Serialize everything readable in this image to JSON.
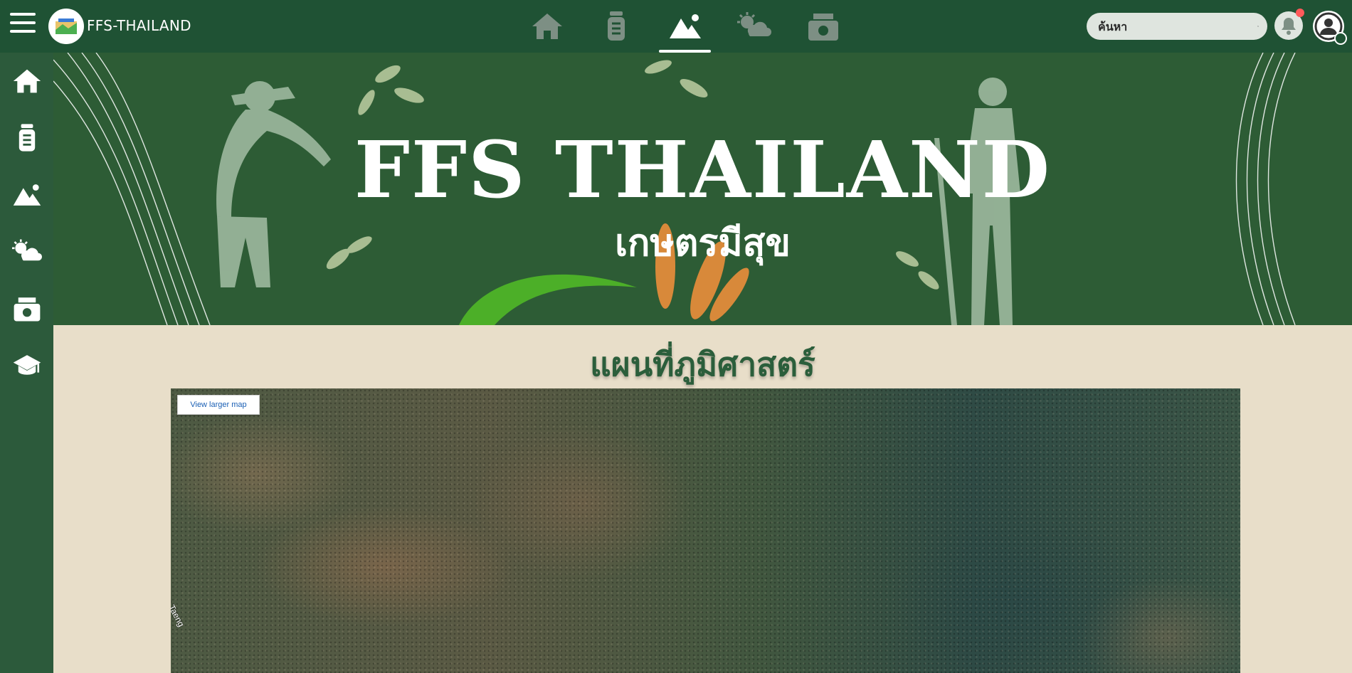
{
  "header": {
    "brand": "FFS-THAILAND",
    "nav_icons": [
      "home-icon",
      "jar-icon",
      "mountain-icon",
      "weather-icon",
      "money-icon"
    ],
    "active_nav": "mountain-icon",
    "search": {
      "placeholder": "ค้นหา"
    },
    "notification_badge_color": "#ff5a5a"
  },
  "sidebar": {
    "items": [
      {
        "icon": "home-icon"
      },
      {
        "icon": "jar-icon"
      },
      {
        "icon": "mountain-icon"
      },
      {
        "icon": "weather-icon"
      },
      {
        "icon": "money-icon"
      },
      {
        "icon": "graduation-cap-icon"
      }
    ]
  },
  "banner": {
    "title": "FFS THAILAND",
    "subtitle": "เกษตรมีสุข"
  },
  "section": {
    "title": "แผนที่ภูมิศาสตร์"
  },
  "map": {
    "view_larger_label": "View larger map",
    "road_label": "Om Taeng"
  },
  "colors": {
    "topbar": "#1f5234",
    "sidebar": "#2c5a3b",
    "banner": "#2d5c35",
    "page_bg": "#e8dec9",
    "section_title": "#2b5e3b"
  }
}
